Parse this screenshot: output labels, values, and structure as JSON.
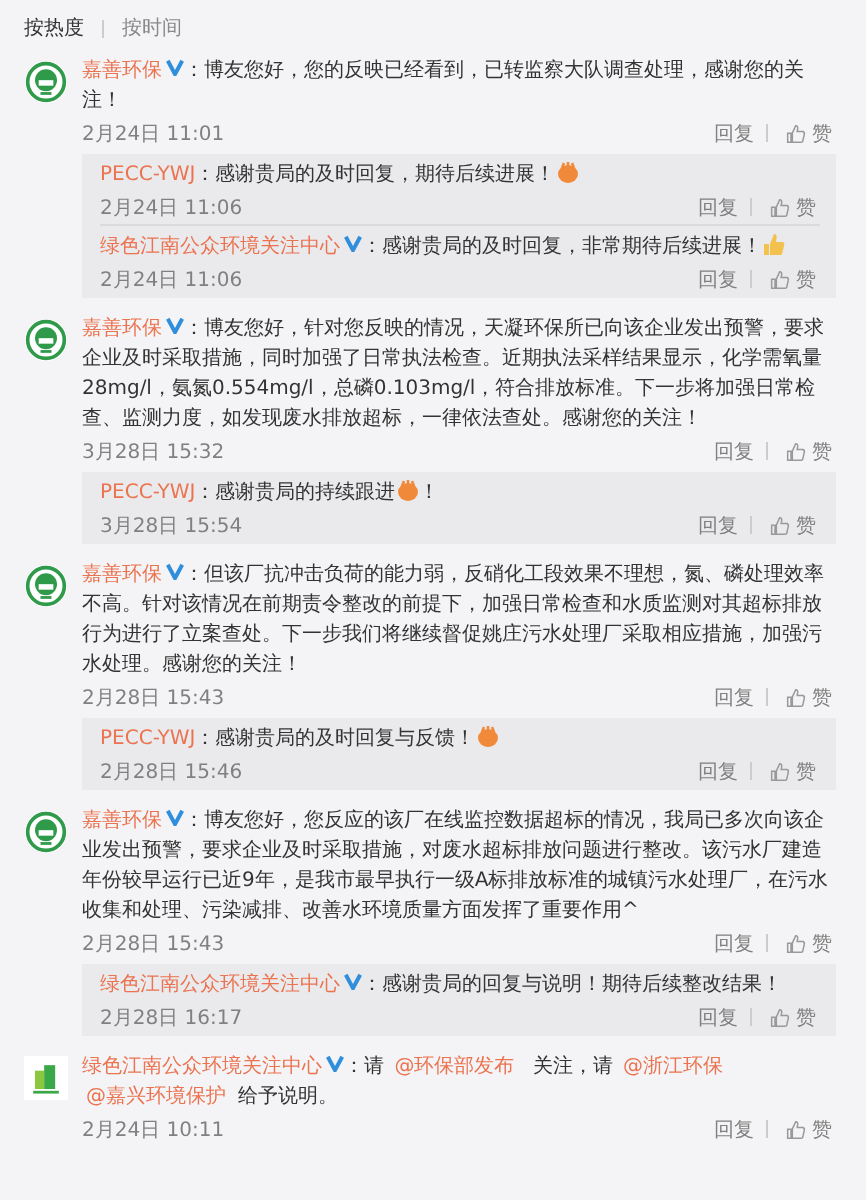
{
  "sort_tabs": [
    {
      "label": "按热度",
      "selected": true
    },
    {
      "label": "按时间",
      "selected": false
    }
  ],
  "comments": [
    {
      "author": "嘉善环保",
      "kind": "emblem",
      "verified": true,
      "parts": [
        {
          "kind": "text",
          "text": "：博友您好，您的反映已经看到，已转监察大队调查处理，感谢您的关注！"
        }
      ],
      "time": "2月24日 11:01",
      "actions": [
        "回复",
        "赞"
      ],
      "replies": [
        {
          "author": "PECC-YWJ",
          "verified": false,
          "parts": [
            {
              "kind": "text",
              "text": "：感谢贵局的及时回复，期待后续进展！"
            },
            {
              "kind": "clap-emoji"
            }
          ],
          "time": "2月24日 11:06",
          "actions": [
            "回复",
            "赞"
          ]
        },
        {
          "author": "绿色江南公众环境关注中心",
          "verified": true,
          "parts": [
            {
              "kind": "text",
              "text": "：感谢贵局的及时回复，非常期待后续进展！"
            },
            {
              "kind": "thumb-emoji"
            }
          ],
          "time": "2月24日 11:06",
          "actions": [
            "回复",
            "赞"
          ]
        }
      ]
    },
    {
      "author": "嘉善环保",
      "kind": "emblem",
      "verified": true,
      "parts": [
        {
          "kind": "text",
          "text": "：博友您好，针对您反映的情况，天凝环保所已向该企业发出预警，要求企业及时采取措施，同时加强了日常执法检查。近期执法采样结果显示，化学需氧量28mg/l，氨氮0.554mg/l，总磷0.103mg/l，符合排放标准。下一步将加强日常检查、监测力度，如发现废水排放超标，一律依法查处。感谢您的关注！"
        }
      ],
      "time": "3月28日 15:32",
      "actions": [
        "回复",
        "赞"
      ],
      "replies": [
        {
          "author": "PECC-YWJ",
          "verified": false,
          "parts": [
            {
              "kind": "text",
              "text": "：感谢贵局的持续跟进"
            },
            {
              "kind": "clap-emoji"
            },
            {
              "kind": "text",
              "text": "！"
            }
          ],
          "time": "3月28日 15:54",
          "actions": [
            "回复",
            "赞"
          ]
        }
      ]
    },
    {
      "author": "嘉善环保",
      "kind": "emblem",
      "verified": true,
      "parts": [
        {
          "kind": "text",
          "text": "：但该厂抗冲击负荷的能力弱，反硝化工段效果不理想，氮、磷处理效率不高。针对该情况在前期责令整改的前提下，加强日常检查和水质监测对其超标排放行为进行了立案查处。下一步我们将继续督促姚庄污水处理厂采取相应措施，加强污水处理。感谢您的关注！"
        }
      ],
      "time": "2月28日 15:43",
      "actions": [
        "回复",
        "赞"
      ],
      "replies": [
        {
          "author": "PECC-YWJ",
          "verified": false,
          "parts": [
            {
              "kind": "text",
              "text": "：感谢贵局的及时回复与反馈！"
            },
            {
              "kind": "clap-emoji"
            }
          ],
          "time": "2月28日 15:46",
          "actions": [
            "回复",
            "赞"
          ]
        }
      ]
    },
    {
      "author": "嘉善环保",
      "kind": "emblem",
      "verified": true,
      "parts": [
        {
          "kind": "text",
          "text": "：博友您好，您反应的该厂在线监控数据超标的情况，我局已多次向该企业发出预警，要求企业及时采取措施，对废水超标排放问题进行整改。该污水厂建造年份较早运行已近9年，是我市最早执行一级A标排放标准的城镇污水处理厂，在污水收集和处理、污染减排、改善水环境质量方面发挥了重要作用^"
        }
      ],
      "time": "2月28日 15:43",
      "actions": [
        "回复",
        "赞"
      ],
      "replies": [
        {
          "author": "绿色江南公众环境关注中心",
          "verified": true,
          "parts": [
            {
              "kind": "text",
              "text": "：感谢贵局的回复与说明！期待后续整改结果！"
            }
          ],
          "time": "2月28日 16:17",
          "actions": [
            "回复",
            "赞"
          ]
        }
      ]
    },
    {
      "author": "绿色江南公众环境关注中心",
      "kind": "building",
      "verified": true,
      "parts": [
        {
          "kind": "text",
          "text": "：请 "
        },
        {
          "kind": "mention",
          "text": "@环保部发布"
        },
        {
          "kind": "text",
          "text": " 关注，请 "
        },
        {
          "kind": "mention",
          "text": "@浙江环保"
        },
        {
          "kind": "mention",
          "text": "@嘉兴环境保护"
        },
        {
          "kind": "text",
          "text": "给予说明。"
        }
      ],
      "time": "2月24日 10:11",
      "actions": [
        "回复",
        "赞"
      ]
    }
  ]
}
